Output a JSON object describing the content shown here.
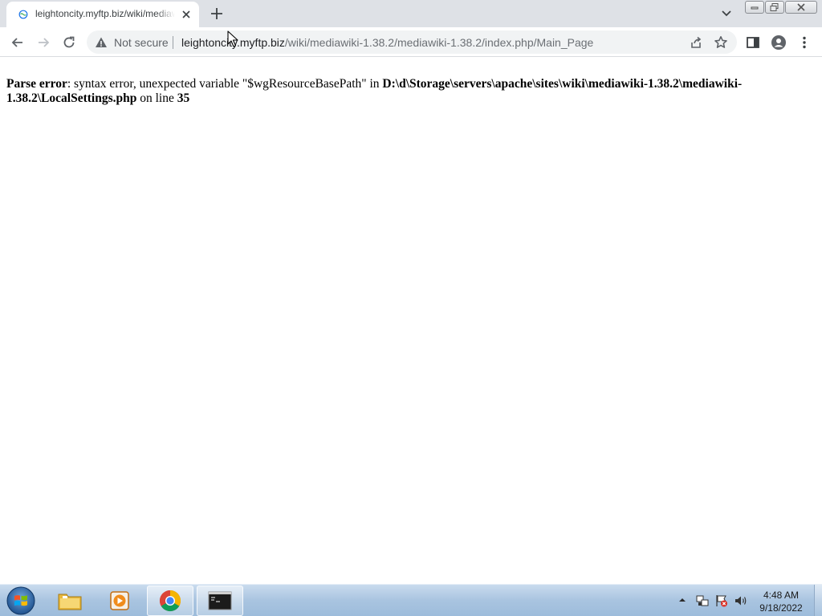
{
  "browser": {
    "tab": {
      "title": "leightoncity.myftp.biz/wiki/mediawiki-1.38.2/mediawiki-1.38.2/index.php/Main_Page"
    },
    "omnibox": {
      "security_label": "Not secure",
      "url_host": "leightoncity.myftp.biz",
      "url_path": "/wiki/mediawiki-1.38.2/mediawiki-1.38.2/index.php/Main_Page"
    }
  },
  "page": {
    "error_label": "Parse error",
    "error_message": ": syntax error, unexpected variable \"$wgResourceBasePath\" in ",
    "file_path": "D:\\d\\Storage\\servers\\apache\\sites\\wiki\\mediawiki-1.38.2\\mediawiki-1.38.2\\LocalSettings.php",
    "line_prefix": " on line ",
    "line_number": "35"
  },
  "taskbar": {
    "pinned": [
      "windows-explorer",
      "windows-media-player",
      "google-chrome",
      "command-prompt"
    ],
    "clock": {
      "time": "4:48 AM",
      "date": "9/18/2022"
    }
  },
  "colors": {
    "tabstrip_bg": "#dee1e6",
    "omnibox_bg": "#f1f3f4",
    "taskbar_bg": "#a9c4e0",
    "text_primary": "#202124",
    "text_secondary": "#5f6368"
  }
}
